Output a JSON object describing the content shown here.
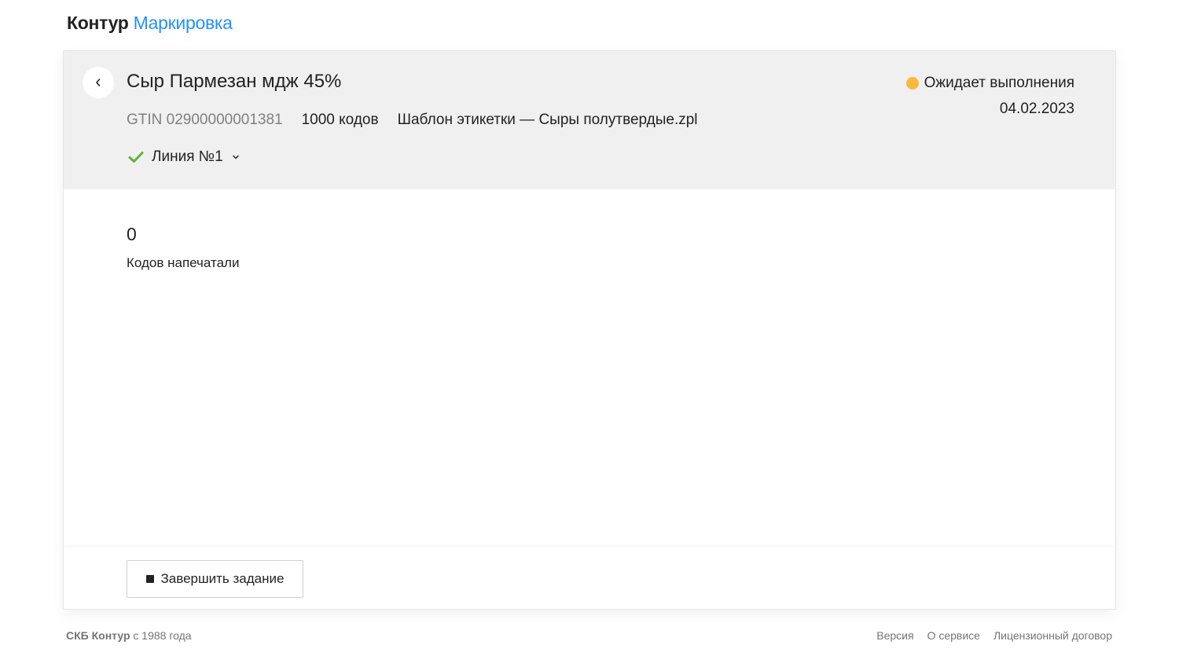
{
  "header": {
    "logo_brand": "Контур",
    "logo_product": "Маркировка"
  },
  "task": {
    "title": "Сыр Пармезан мдж 45%",
    "gtin": "GTIN 02900000001381",
    "codes_count": "1000 кодов",
    "template": "Шаблон этикетки — Сыры полутвердые.zpl",
    "line": "Линия №1",
    "status": "Ожидает выполнения",
    "date": "04.02.2023"
  },
  "stats": {
    "printed_value": "0",
    "printed_label": "Кодов напечатали"
  },
  "actions": {
    "finish_label": "Завершить задание"
  },
  "footer": {
    "company": "СКБ Контур",
    "since": " с 1988 года",
    "links": [
      "Версия",
      "О сервисе",
      "Лицензионный договор"
    ]
  },
  "colors": {
    "accent": "#2291ff",
    "status_pending": "#fcb73e",
    "check": "#5fb33c",
    "header_bg": "#f0f0f0"
  },
  "icons": {
    "back": "chevron-left-icon",
    "line_status": "check-icon",
    "line_dropdown": "chevron-down-icon",
    "finish": "stop-icon"
  }
}
